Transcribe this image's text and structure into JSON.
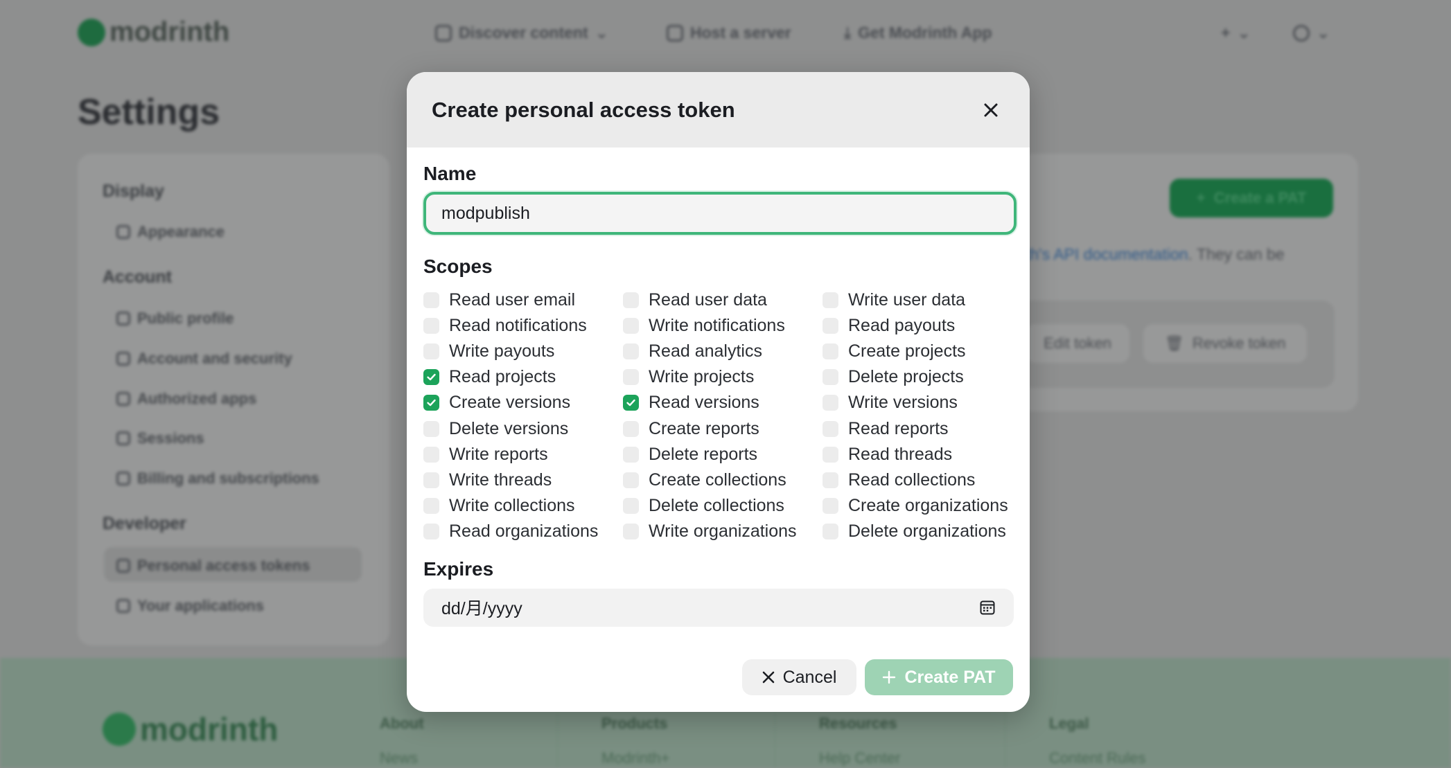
{
  "background": {
    "brand": "modrinth",
    "nav": {
      "discover": "Discover content",
      "host": "Host a server",
      "app": "Get Modrinth App"
    },
    "page_title": "Settings",
    "sidebar": {
      "display_heading": "Display",
      "appearance": "Appearance",
      "account_heading": "Account",
      "public_profile": "Public profile",
      "account_security": "Account and security",
      "authorized_apps": "Authorized apps",
      "sessions": "Sessions",
      "billing": "Billing and subscriptions",
      "developer_heading": "Developer",
      "pats": "Personal access tokens",
      "your_apps": "Your applications"
    },
    "main": {
      "create_pat_button": "Create a PAT",
      "text_link": "th's API documentation",
      "text_rest": ". They can be",
      "edit_token": "Edit token",
      "revoke_token": "Revoke token"
    },
    "footer": {
      "about": "About",
      "products": "Products",
      "resources": "Resources",
      "legal": "Legal",
      "news": "News",
      "modrinth_plus": "Modrinth+",
      "help_center": "Help Center",
      "content_rules": "Content Rules"
    }
  },
  "modal": {
    "title": "Create personal access token",
    "name_label": "Name",
    "name_value": "modpublish",
    "scopes_label": "Scopes",
    "scopes": [
      {
        "label": "Read user email",
        "checked": false
      },
      {
        "label": "Read user data",
        "checked": false
      },
      {
        "label": "Write user data",
        "checked": false
      },
      {
        "label": "Read notifications",
        "checked": false
      },
      {
        "label": "Write notifications",
        "checked": false
      },
      {
        "label": "Read payouts",
        "checked": false
      },
      {
        "label": "Write payouts",
        "checked": false
      },
      {
        "label": "Read analytics",
        "checked": false
      },
      {
        "label": "Create projects",
        "checked": false
      },
      {
        "label": "Read projects",
        "checked": true
      },
      {
        "label": "Write projects",
        "checked": false
      },
      {
        "label": "Delete projects",
        "checked": false
      },
      {
        "label": "Create versions",
        "checked": true
      },
      {
        "label": "Read versions",
        "checked": true
      },
      {
        "label": "Write versions",
        "checked": false
      },
      {
        "label": "Delete versions",
        "checked": false
      },
      {
        "label": "Create reports",
        "checked": false
      },
      {
        "label": "Read reports",
        "checked": false
      },
      {
        "label": "Write reports",
        "checked": false
      },
      {
        "label": "Delete reports",
        "checked": false
      },
      {
        "label": "Read threads",
        "checked": false
      },
      {
        "label": "Write threads",
        "checked": false
      },
      {
        "label": "Create collections",
        "checked": false
      },
      {
        "label": "Read collections",
        "checked": false
      },
      {
        "label": "Write collections",
        "checked": false
      },
      {
        "label": "Delete collections",
        "checked": false
      },
      {
        "label": "Create organizations",
        "checked": false
      },
      {
        "label": "Read organizations",
        "checked": false
      },
      {
        "label": "Write organizations",
        "checked": false
      },
      {
        "label": "Delete organizations",
        "checked": false
      }
    ],
    "expires_label": "Expires",
    "expires_placeholder": "dd/月/yyyy",
    "cancel_label": "Cancel",
    "create_label": "Create PAT"
  },
  "colors": {
    "accent": "#1ca35a",
    "focus_ring": "#3fb67a",
    "create_disabled": "#9ed3b4"
  }
}
